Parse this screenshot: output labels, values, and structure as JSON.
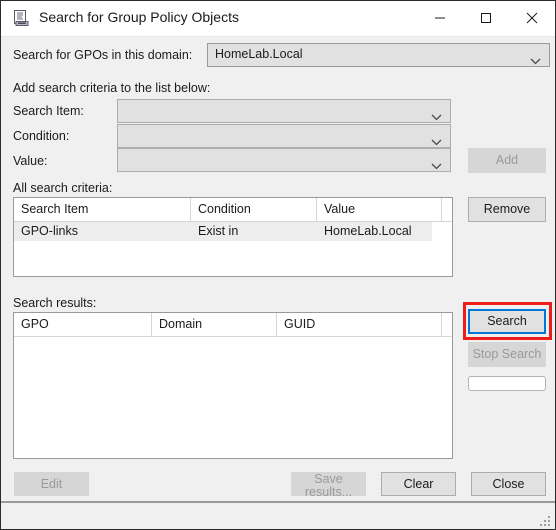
{
  "window": {
    "title": "Search for Group Policy Objects",
    "icon": "gpo-scroll-icon",
    "controls": {
      "minimize": "minimize-icon",
      "maximize": "maximize-icon",
      "close": "close-icon"
    }
  },
  "domain": {
    "label": "Search for GPOs in this domain:",
    "value": "HomeLab.Local",
    "placeholder": "HomeLab.Local"
  },
  "criteria_form": {
    "heading": "Add search criteria to the list below:",
    "fields": [
      {
        "label": "Search Item:",
        "value": "",
        "placeholder": ""
      },
      {
        "label": "Condition:",
        "value": "",
        "placeholder": ""
      },
      {
        "label": "Value:",
        "value": "",
        "placeholder": ""
      }
    ],
    "add_button": "Add"
  },
  "criteria_list": {
    "heading": "All search criteria:",
    "columns": [
      "Search Item",
      "Condition",
      "Value"
    ],
    "rows": [
      {
        "search_item": "GPO-links",
        "condition": "Exist in",
        "value": "HomeLab.Local"
      }
    ],
    "remove_button": "Remove"
  },
  "results": {
    "heading": "Search results:",
    "columns": [
      "GPO",
      "Domain",
      "GUID"
    ],
    "rows": [],
    "search_button": "Search",
    "stop_button": "Stop Search",
    "progress_value": ""
  },
  "footer": {
    "edit_button": "Edit",
    "save_button": "Save results...",
    "clear_button": "Clear",
    "close_button": "Close"
  },
  "statusbar": {
    "text": "",
    "grip": "resize-grip-icon"
  },
  "colors": {
    "accent_focus": "#0078d7",
    "annotation": "#ef1c1c",
    "dialog_bg": "#f0f0f0",
    "control_bg": "#e1e1e1",
    "disabled_text": "#9a9a9a"
  }
}
